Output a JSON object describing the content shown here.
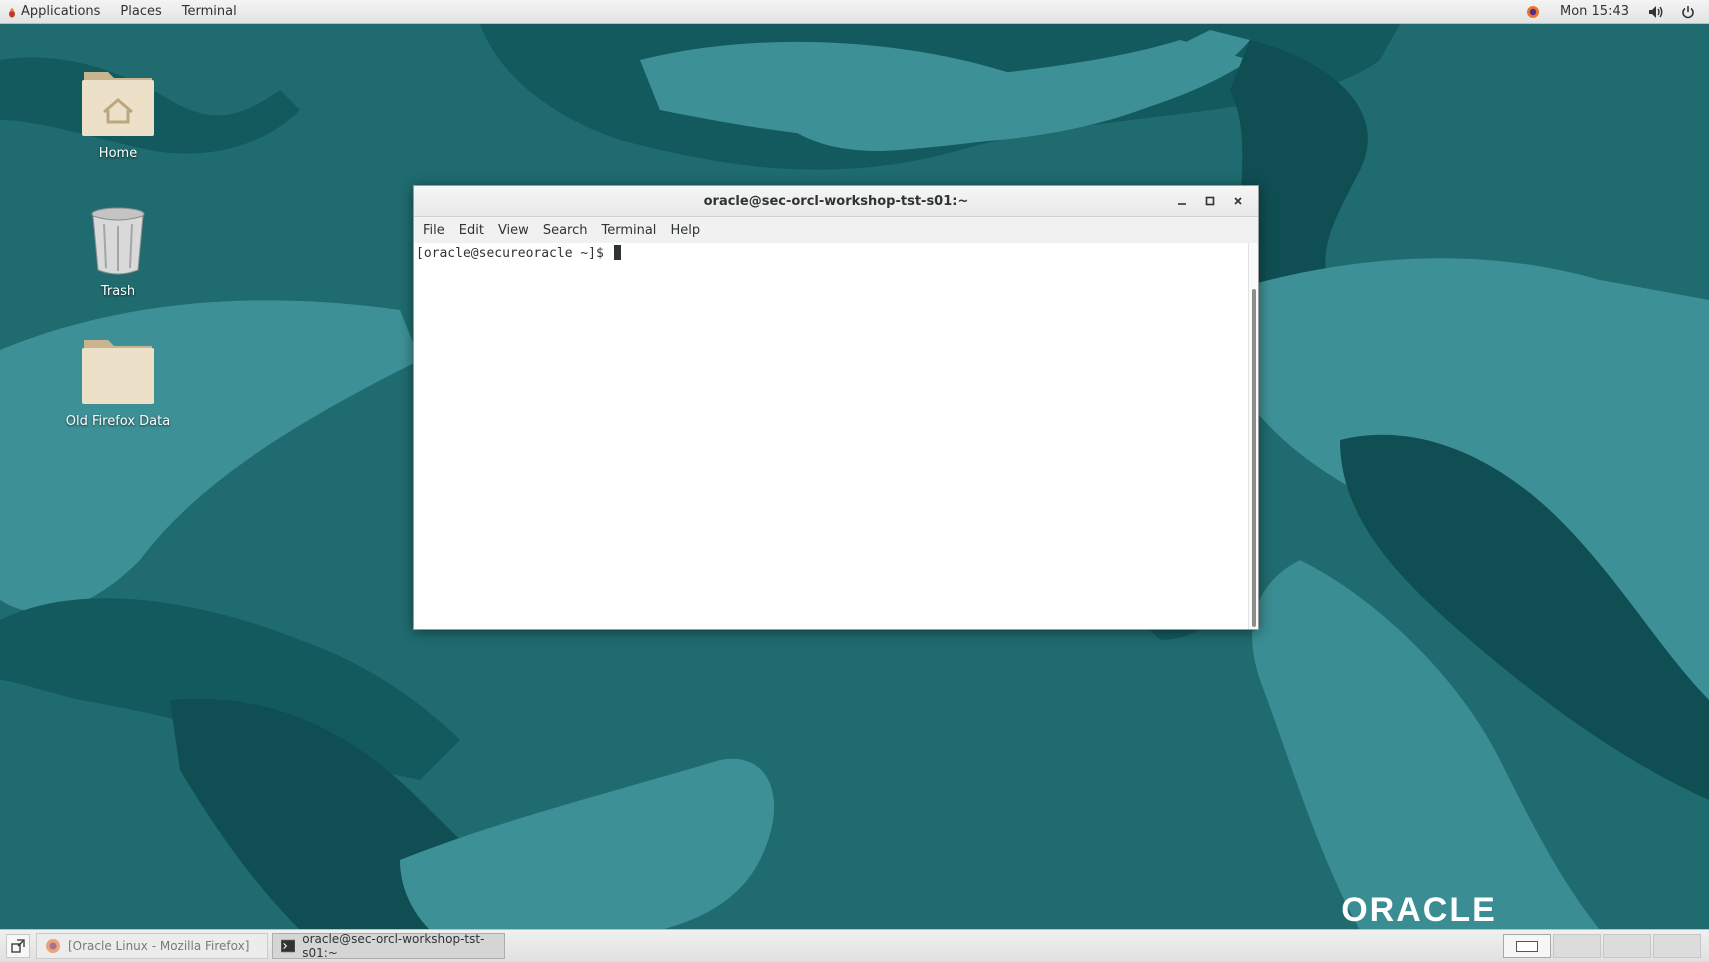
{
  "top_panel": {
    "applications_label": "Applications",
    "places_label": "Places",
    "terminal_label": "Terminal",
    "clock": "Mon 15:43"
  },
  "desktop_icons": [
    {
      "label": "Home"
    },
    {
      "label": "Trash"
    },
    {
      "label": "Old Firefox Data"
    }
  ],
  "terminal_window": {
    "title": "oracle@sec-orcl-workshop-tst-s01:~",
    "menu": [
      "File",
      "Edit",
      "View",
      "Search",
      "Terminal",
      "Help"
    ],
    "prompt": "[oracle@secureoracle ~]$ ",
    "controls": {
      "minimize": "–",
      "maximize": "▢",
      "close": "✕"
    }
  },
  "wallpaper": {
    "logo_text": "ORACLE"
  },
  "bottom_panel": {
    "tasks": [
      {
        "label": "[Oracle Linux - Mozilla Firefox]",
        "active": false
      },
      {
        "label": "oracle@sec-orcl-workshop-tst-s01:~",
        "active": true
      }
    ],
    "workspaces": 4,
    "active_workspace": 1
  },
  "colors": {
    "wallpaper_base": "#1f6b6f",
    "wallpaper_light": "#3d9196",
    "wallpaper_dark": "#0f4e52",
    "panel": "#e8e8e8"
  },
  "icons": [
    "applications-icon",
    "firefox-tray-icon",
    "volume-icon",
    "power-icon",
    "home-folder-icon",
    "trash-icon",
    "folder-icon",
    "show-desktop-icon",
    "firefox-icon",
    "terminal-icon"
  ]
}
